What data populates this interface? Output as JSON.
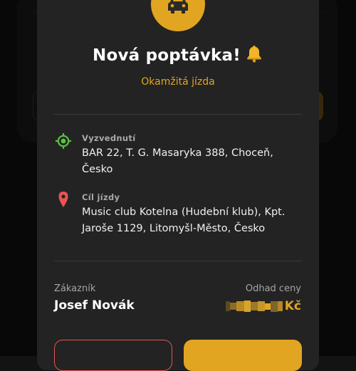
{
  "colors": {
    "accent": "#e2a521",
    "pickup_icon": "#5cc243",
    "destination_icon": "#e85454",
    "decline_border": "#e55454"
  },
  "header": {
    "icon": "car-icon",
    "title": "Nová poptávka!",
    "title_icon": "bell-icon",
    "subtitle": "Okamžitá jízda"
  },
  "pickup": {
    "icon": "crosshair-location-icon",
    "label": "Vyzvednutí",
    "address": "BAR 22, T. G. Masaryka 388, Choceň, Česko"
  },
  "destination": {
    "icon": "map-pin-icon",
    "label": "Cíl jízdy",
    "address": "Music club Kotelna (Hudební klub), Kpt. Jaroše 1129, Litomyšl-Město, Česko"
  },
  "customer": {
    "label": "Zákazník",
    "name": "Josef Novák"
  },
  "price": {
    "label": "Odhad ceny",
    "value": "",
    "currency": "Kč"
  }
}
